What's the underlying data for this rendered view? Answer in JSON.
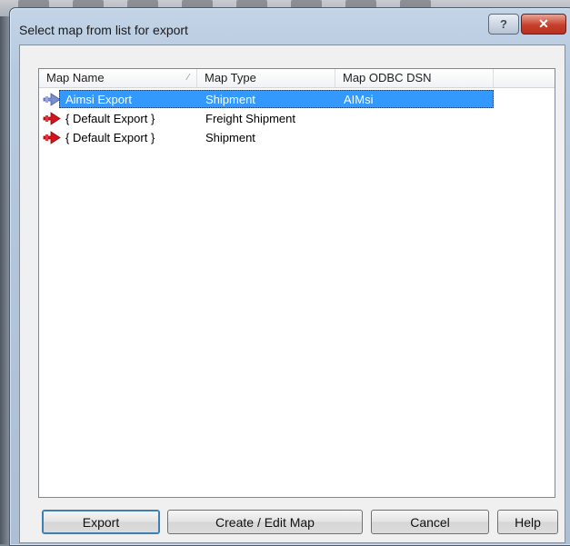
{
  "dialog": {
    "title": "Select map from list for export",
    "help_caption": "?",
    "close_caption": "✕"
  },
  "list": {
    "columns": [
      "Map Name",
      "Map Type",
      "Map ODBC DSN"
    ],
    "rows": [
      {
        "name": "Aimsi Export",
        "type": "Shipment",
        "dsn": "AIMsi",
        "selected": true,
        "icon": "map-arrow-icon"
      },
      {
        "name": "{ Default Export }",
        "type": "Freight Shipment",
        "dsn": "",
        "selected": false,
        "icon": "map-arrow-icon"
      },
      {
        "name": "{ Default Export }",
        "type": "Shipment",
        "dsn": "",
        "selected": false,
        "icon": "map-arrow-icon"
      }
    ]
  },
  "buttons": {
    "export": "Export",
    "create_edit": "Create / Edit Map",
    "cancel": "Cancel",
    "help": "Help"
  },
  "colors": {
    "selection": "#3399ff",
    "arrow": "#d4141c"
  }
}
